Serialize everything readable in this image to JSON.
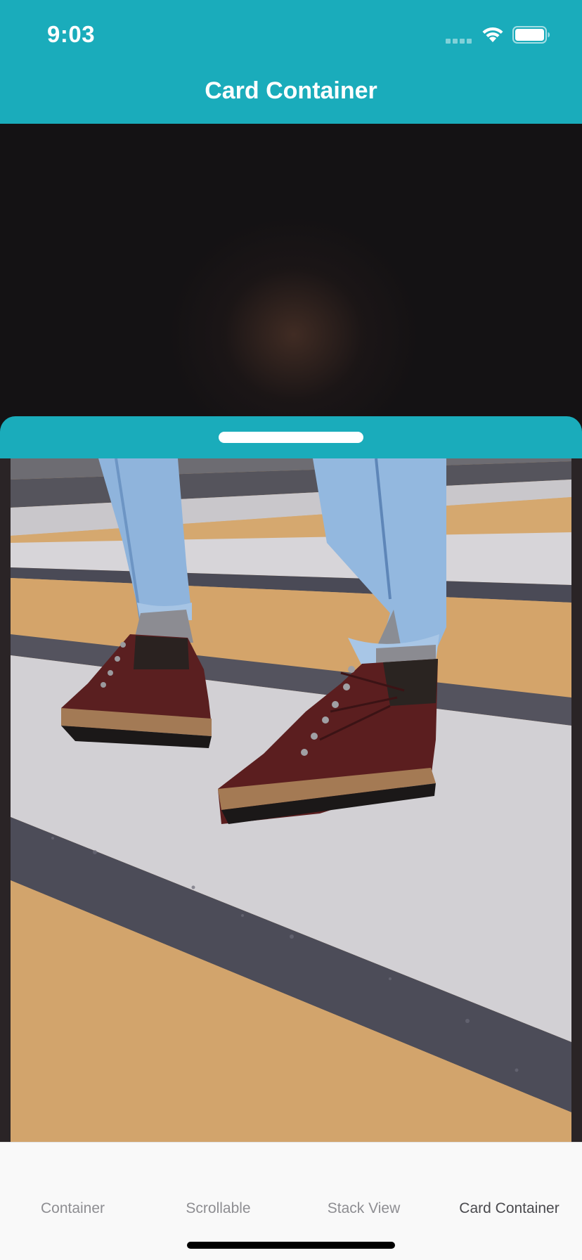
{
  "status_bar": {
    "time": "9:03"
  },
  "header": {
    "title": "Card Container"
  },
  "colors": {
    "accent": "#1aacbb",
    "backdrop": "#141214",
    "tab_inactive": "#8e8e92",
    "tab_active": "#4a4a4e"
  },
  "card": {
    "image_subject": "brown leather lace-up boots on a painted crosswalk"
  },
  "tabs": [
    {
      "label": "Container",
      "active": false
    },
    {
      "label": "Scrollable",
      "active": false
    },
    {
      "label": "Stack View",
      "active": false
    },
    {
      "label": "Card Container",
      "active": true
    }
  ]
}
